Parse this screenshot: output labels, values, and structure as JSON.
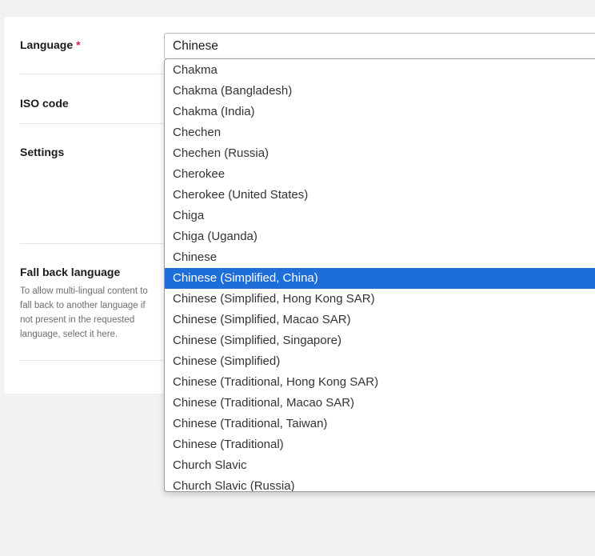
{
  "form": {
    "language_label": "Language",
    "required_marker": "*",
    "language_value": "Chinese",
    "iso_label": "ISO code",
    "settings_label": "Settings",
    "fallback_label": "Fall back language",
    "fallback_help": "To allow multi-lingual content to fall back to another language if not present in the requested language, select it here."
  },
  "dropdown": {
    "options": [
      "Chakma",
      "Chakma (Bangladesh)",
      "Chakma (India)",
      "Chechen",
      "Chechen (Russia)",
      "Cherokee",
      "Cherokee (United States)",
      "Chiga",
      "Chiga (Uganda)",
      "Chinese",
      "Chinese (Simplified, China)",
      "Chinese (Simplified, Hong Kong SAR)",
      "Chinese (Simplified, Macao SAR)",
      "Chinese (Simplified, Singapore)",
      "Chinese (Simplified)",
      "Chinese (Traditional, Hong Kong SAR)",
      "Chinese (Traditional, Macao SAR)",
      "Chinese (Traditional, Taiwan)",
      "Chinese (Traditional)",
      "Church Slavic",
      "Church Slavic (Russia)"
    ],
    "highlighted": "Chinese (Simplified, China)",
    "highlight_color": "#1e6ed9"
  }
}
